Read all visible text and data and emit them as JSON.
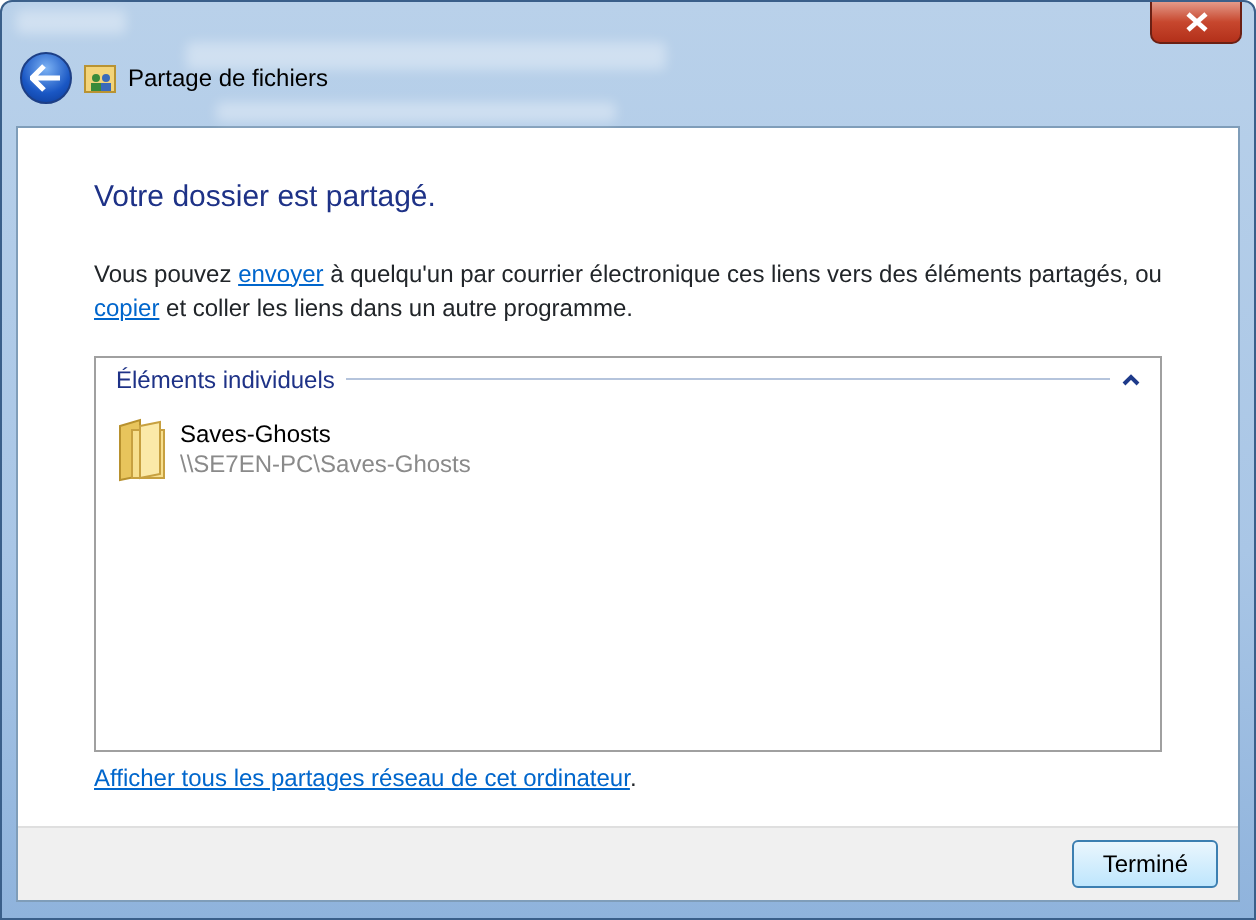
{
  "window": {
    "title": "Partage de fichiers"
  },
  "heading": "Votre dossier est partagé.",
  "intro": [
    {
      "kind": "text",
      "text": "Vous pouvez "
    },
    {
      "kind": "link",
      "text": "envoyer"
    },
    {
      "kind": "text",
      "text": " à quelqu'un par courrier électronique ces liens vers des éléments partagés, ou "
    },
    {
      "kind": "link",
      "text": "copier"
    },
    {
      "kind": "text",
      "text": " et coller les liens dans un autre programme."
    }
  ],
  "group": {
    "title": "Éléments individuels",
    "expanded": true,
    "items": [
      {
        "name": "Saves-Ghosts",
        "path": "\\\\SE7EN-PC\\Saves-Ghosts"
      }
    ]
  },
  "footer_link": {
    "text": "Afficher tous les partages réseau de cet ordinateur",
    "suffix": "."
  },
  "buttons": [
    "Terminé"
  ]
}
